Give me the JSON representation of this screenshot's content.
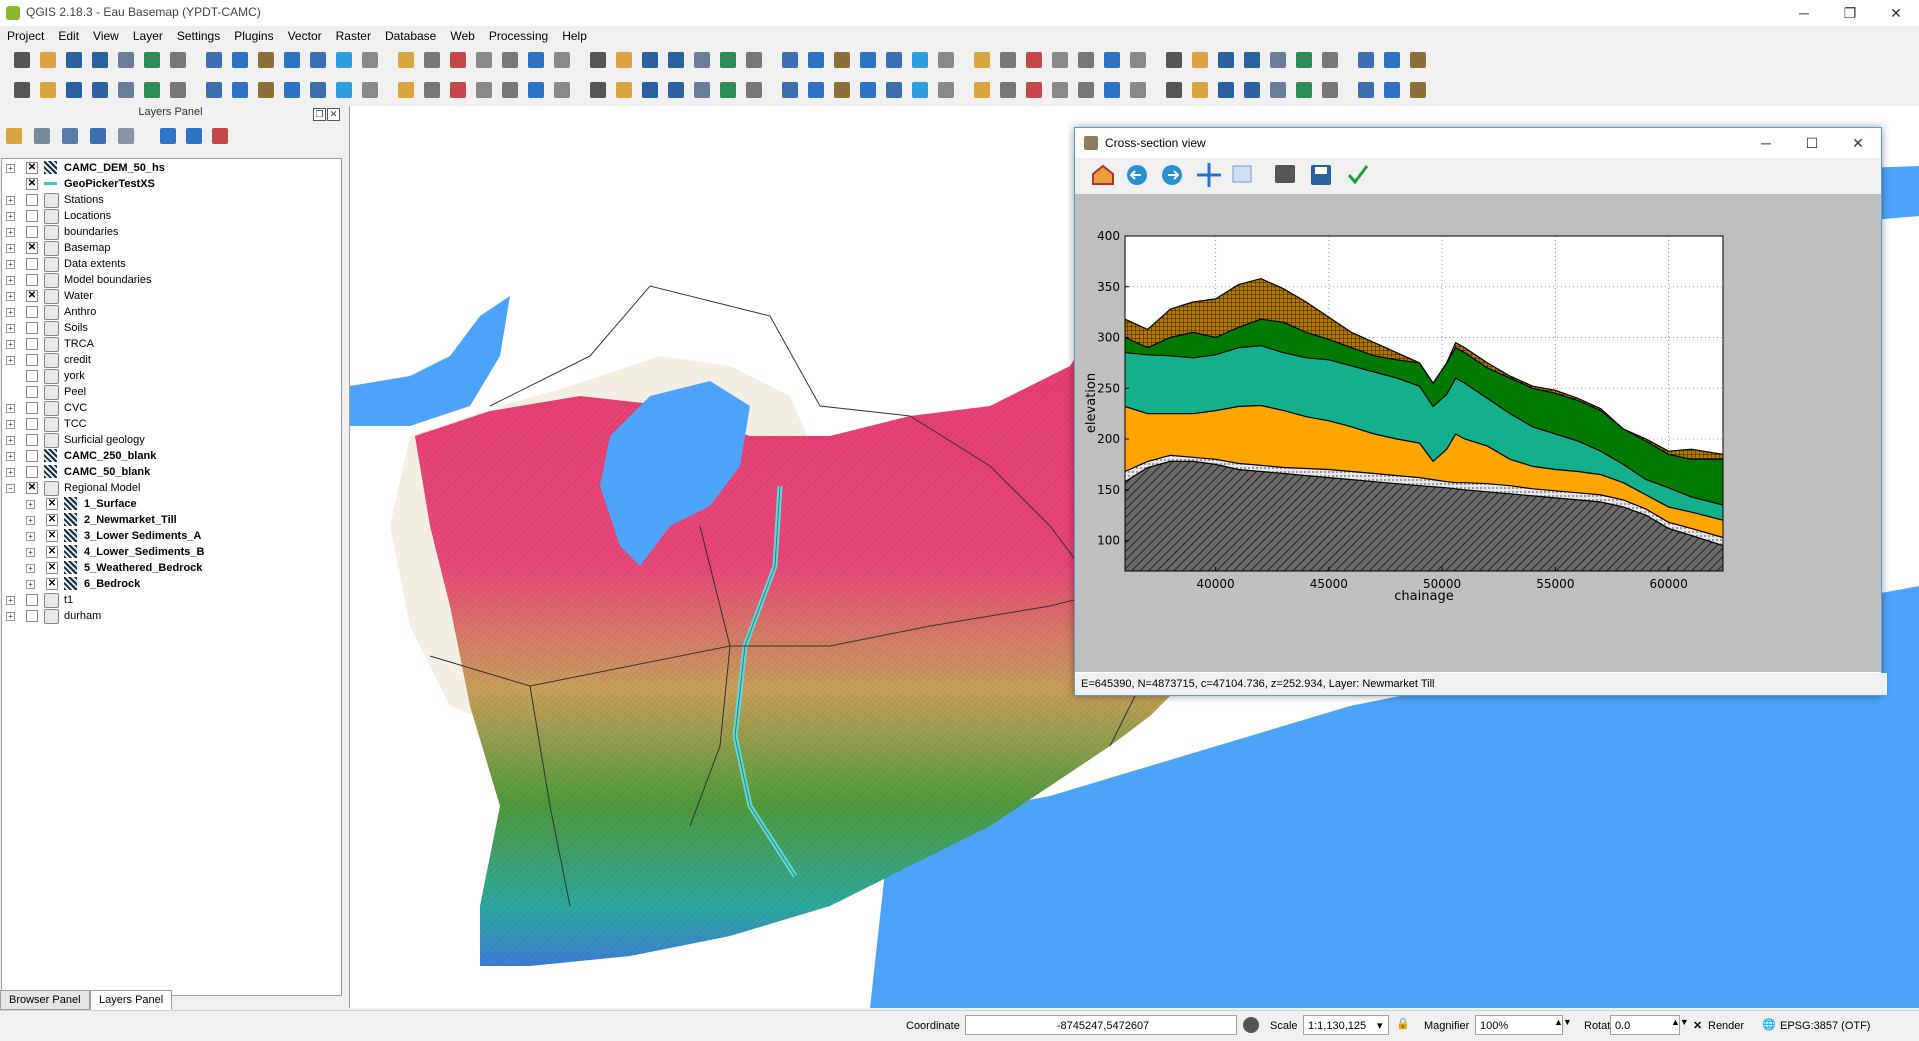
{
  "app": {
    "title": "QGIS 2.18.3 - Eau Basemap (YPDT-CAMC)"
  },
  "window_controls": {
    "minimize": "─",
    "restore": "❐",
    "close": "✕"
  },
  "menu": [
    "Project",
    "Edit",
    "View",
    "Layer",
    "Settings",
    "Plugins",
    "Vector",
    "Raster",
    "Database",
    "Web",
    "Processing",
    "Help"
  ],
  "layers_panel": {
    "title": "Layers Panel",
    "items": [
      {
        "label": "CAMC_DEM_50_hs",
        "checked": true,
        "bold": true,
        "icon": "raster-dem-icon",
        "indent": 0,
        "expander": "+"
      },
      {
        "label": "GeoPickerTestXS",
        "checked": true,
        "bold": true,
        "icon": "line-layer-icon",
        "indent": 0,
        "expander": ""
      },
      {
        "label": "Stations",
        "checked": false,
        "bold": false,
        "icon": "group-icon",
        "indent": 0,
        "expander": "+"
      },
      {
        "label": "Locations",
        "checked": false,
        "bold": false,
        "icon": "group-icon",
        "indent": 0,
        "expander": "+"
      },
      {
        "label": "boundaries",
        "checked": false,
        "bold": false,
        "icon": "group-icon",
        "indent": 0,
        "expander": "+"
      },
      {
        "label": "Basemap",
        "checked": true,
        "bold": false,
        "icon": "group-icon",
        "indent": 0,
        "expander": "+"
      },
      {
        "label": "Data extents",
        "checked": false,
        "bold": false,
        "icon": "group-icon",
        "indent": 0,
        "expander": "+"
      },
      {
        "label": "Model boundaries",
        "checked": false,
        "bold": false,
        "icon": "group-icon",
        "indent": 0,
        "expander": "+"
      },
      {
        "label": "Water",
        "checked": true,
        "bold": false,
        "icon": "group-icon",
        "indent": 0,
        "expander": "+"
      },
      {
        "label": "Anthro",
        "checked": false,
        "bold": false,
        "icon": "group-icon",
        "indent": 0,
        "expander": "+"
      },
      {
        "label": "Soils",
        "checked": false,
        "bold": false,
        "icon": "group-icon",
        "indent": 0,
        "expander": "+"
      },
      {
        "label": "TRCA",
        "checked": false,
        "bold": false,
        "icon": "group-icon",
        "indent": 0,
        "expander": "+"
      },
      {
        "label": "credit",
        "checked": false,
        "bold": false,
        "icon": "group-icon",
        "indent": 0,
        "expander": "+"
      },
      {
        "label": "york",
        "checked": false,
        "bold": false,
        "icon": "group-icon",
        "indent": 0,
        "expander": ""
      },
      {
        "label": "Peel",
        "checked": false,
        "bold": false,
        "icon": "group-icon",
        "indent": 0,
        "expander": ""
      },
      {
        "label": "CVC",
        "checked": false,
        "bold": false,
        "icon": "group-icon",
        "indent": 0,
        "expander": "+"
      },
      {
        "label": "TCC",
        "checked": false,
        "bold": false,
        "icon": "group-icon",
        "indent": 0,
        "expander": "+"
      },
      {
        "label": "Surficial geology",
        "checked": false,
        "bold": false,
        "icon": "group-icon",
        "indent": 0,
        "expander": "+"
      },
      {
        "label": "CAMC_250_blank",
        "checked": false,
        "bold": true,
        "icon": "raster-dem-icon",
        "indent": 0,
        "expander": "+"
      },
      {
        "label": "CAMC_50_blank",
        "checked": false,
        "bold": true,
        "icon": "raster-dem-icon",
        "indent": 0,
        "expander": "+"
      },
      {
        "label": "Regional Model",
        "checked": true,
        "bold": false,
        "icon": "group-icon",
        "indent": 0,
        "expander": "−"
      },
      {
        "label": "1_Surface",
        "checked": true,
        "bold": true,
        "icon": "raster-dem-icon",
        "indent": 1,
        "expander": "+"
      },
      {
        "label": "2_Newmarket_Till",
        "checked": true,
        "bold": true,
        "icon": "raster-dem-icon",
        "indent": 1,
        "expander": "+"
      },
      {
        "label": "3_Lower Sediments_A",
        "checked": true,
        "bold": true,
        "icon": "raster-dem-icon",
        "indent": 1,
        "expander": "+"
      },
      {
        "label": "4_Lower_Sediments_B",
        "checked": true,
        "bold": true,
        "icon": "raster-dem-icon",
        "indent": 1,
        "expander": "+"
      },
      {
        "label": "5_Weathered_Bedrock",
        "checked": true,
        "bold": true,
        "icon": "raster-dem-icon",
        "indent": 1,
        "expander": "+"
      },
      {
        "label": "6_Bedrock",
        "checked": true,
        "bold": true,
        "icon": "raster-dem-icon",
        "indent": 1,
        "expander": "+"
      },
      {
        "label": "t1",
        "checked": false,
        "bold": false,
        "icon": "group-icon",
        "indent": 0,
        "expander": "+"
      },
      {
        "label": "durham",
        "checked": false,
        "bold": false,
        "icon": "group-icon",
        "indent": 0,
        "expander": "+"
      }
    ]
  },
  "panel_tabs": [
    "Browser Panel",
    "Layers Panel"
  ],
  "cross_section": {
    "title": "Cross-section view",
    "status": "E=645390, N=4873715, c=47104.736, z=252.934, Layer: Newmarket Till",
    "tools": [
      "home-icon",
      "back-arrow-icon",
      "forward-arrow-icon",
      "pan-icon",
      "zoom-icon",
      "configure-subplots-icon",
      "save-icon",
      "check-icon"
    ]
  },
  "chart_data": {
    "type": "area",
    "xlabel": "chainage",
    "ylabel": "elevation",
    "xlim": [
      36000,
      62400
    ],
    "ylim": [
      70,
      400
    ],
    "xticks": [
      40000,
      45000,
      50000,
      55000,
      60000
    ],
    "yticks": [
      100,
      150,
      200,
      250,
      300,
      350,
      400
    ],
    "grid": true,
    "x": [
      36000,
      37000,
      38000,
      39000,
      40000,
      41000,
      42000,
      43000,
      44000,
      45000,
      46000,
      47000,
      48000,
      49000,
      49600,
      50200,
      50600,
      51000,
      52000,
      53000,
      54000,
      55000,
      56000,
      57000,
      58000,
      59000,
      60000,
      61000,
      62400
    ],
    "series": [
      {
        "pattern": "hatch-dark",
        "color": "#6a6a6a",
        "values": [
          158,
          172,
          178,
          178,
          175,
          170,
          168,
          166,
          164,
          162,
          160,
          158,
          156,
          154,
          153,
          152,
          151,
          150,
          148,
          146,
          144,
          142,
          140,
          138,
          133,
          125,
          112,
          105,
          95
        ]
      },
      {
        "pattern": "dots",
        "color": "#d9d9d9",
        "values": [
          168,
          178,
          184,
          182,
          180,
          176,
          174,
          172,
          171,
          170,
          168,
          166,
          164,
          162,
          160,
          158,
          157,
          157,
          156,
          154,
          151,
          149,
          147,
          145,
          140,
          131,
          118,
          112,
          103
        ]
      },
      {
        "pattern": "solid",
        "color": "#ffa500",
        "values": [
          232,
          225,
          225,
          225,
          228,
          232,
          233,
          228,
          222,
          218,
          212,
          205,
          200,
          196,
          178,
          190,
          205,
          200,
          193,
          180,
          173,
          170,
          168,
          165,
          157,
          145,
          133,
          128,
          120
        ]
      },
      {
        "pattern": "solid",
        "color": "#13b08c",
        "values": [
          285,
          283,
          282,
          280,
          283,
          290,
          292,
          285,
          280,
          278,
          272,
          266,
          260,
          252,
          232,
          244,
          260,
          255,
          240,
          225,
          212,
          205,
          198,
          188,
          175,
          160,
          152,
          143,
          135
        ]
      },
      {
        "pattern": "solid",
        "color": "#007a00",
        "values": [
          300,
          290,
          300,
          305,
          300,
          310,
          318,
          315,
          305,
          298,
          290,
          282,
          278,
          275,
          255,
          275,
          290,
          285,
          270,
          260,
          250,
          245,
          238,
          228,
          210,
          198,
          185,
          180,
          180
        ]
      },
      {
        "pattern": "cross",
        "color": "#b47800",
        "values": [
          318,
          308,
          328,
          335,
          338,
          352,
          358,
          348,
          335,
          320,
          305,
          295,
          285,
          275,
          255,
          275,
          295,
          290,
          275,
          262,
          252,
          248,
          240,
          230,
          210,
          200,
          188,
          190,
          185
        ]
      }
    ]
  },
  "status_bar": {
    "coordinate_label": "Coordinate",
    "coordinate_value": "-8745247,5472607",
    "scale_label": "Scale",
    "scale_value": "1:1,130,125",
    "magnifier_label": "Magnifier",
    "magnifier_value": "100%",
    "rotation_label": "Rotation",
    "rotation_value": "0.0",
    "render_label": "Render",
    "crs": "EPSG:3857 (OTF)"
  }
}
